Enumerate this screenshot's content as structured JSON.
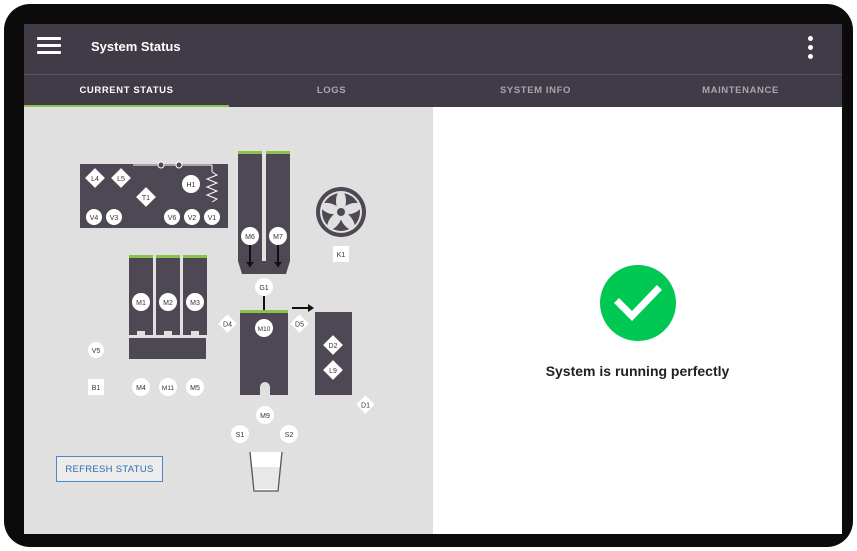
{
  "app": {
    "title": "System Status"
  },
  "tabs": [
    {
      "label": "CURRENT STATUS"
    },
    {
      "label": "LOGS"
    },
    {
      "label": "SYSTEM INFO"
    },
    {
      "label": "MAINTENANCE"
    }
  ],
  "status": {
    "message": "System is running perfectly"
  },
  "actions": {
    "refresh_label": "REFRESH STATUS"
  },
  "colors": {
    "appbar": "#403b46",
    "accent": "#8bc34a",
    "success": "#00c853",
    "component": "#4d4853"
  },
  "diagram": {
    "panel": {
      "l4": "L4",
      "l5": "L5",
      "t1": "T1",
      "h1": "H1",
      "v4": "V4",
      "v3": "V3",
      "v6": "V6",
      "v2": "V2",
      "v1": "V1"
    },
    "m6": "M6",
    "m7": "M7",
    "k1": "K1",
    "g1": "G1",
    "m1": "M1",
    "m2": "M2",
    "m3": "M3",
    "d4": "D4",
    "m10": "M10",
    "d5": "D5",
    "d2": "D2",
    "l9": "L9",
    "v5": "V5",
    "b1": "B1",
    "m4": "M4",
    "m11": "M11",
    "m5": "M5",
    "m9": "M9",
    "d1": "D1",
    "s1": "S1",
    "s2": "S2"
  }
}
